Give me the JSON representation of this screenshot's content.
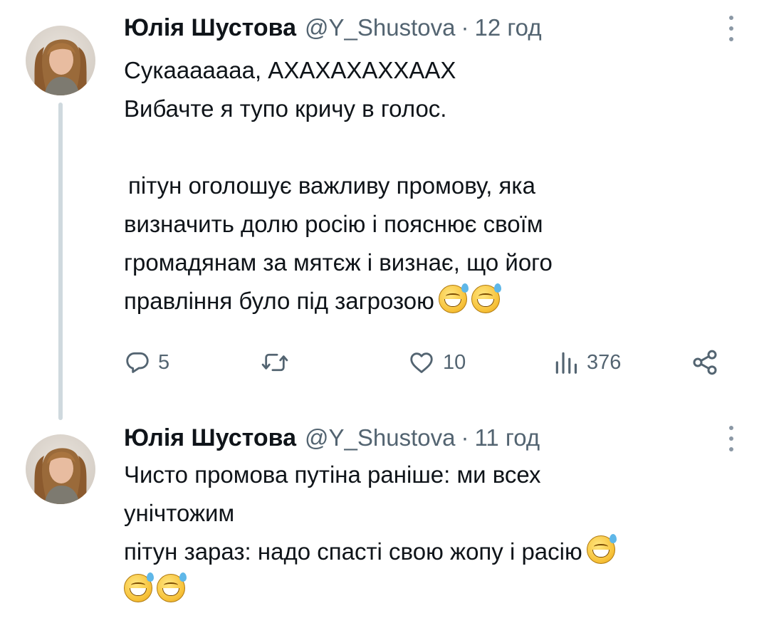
{
  "tweets": [
    {
      "author_name": "Юлія Шустова",
      "handle": "@Y_Shustova",
      "separator": "·",
      "time": "12 год",
      "lines": [
        "Сукааааааа, АХАХАХАХХААХ",
        "Вибачте я тупо кричу в голос.",
        "",
        "пітун оголошує важливу промову, яка",
        "визначить долю росію і пояснює своїм",
        "громадянам за мятєж і визнає, що його",
        "правління було під загрозою"
      ],
      "emoji": [
        "grinning-face-with-sweat",
        "grinning-face-with-sweat"
      ],
      "actions": {
        "reply_count": "5",
        "retweet_count": "",
        "like_count": "10",
        "view_count": "376"
      }
    },
    {
      "author_name": "Юлія Шустова",
      "handle": "@Y_Shustova",
      "separator": "·",
      "time": "11 год",
      "lines": [
        "Чисто промова путіна раніше: ми всех",
        "унічтожим",
        "пітун зараз: надо спасті свою жопу і расію"
      ],
      "emoji": [
        "grinning-face-with-sweat",
        "grinning-face-with-sweat",
        "grinning-face-with-sweat"
      ]
    }
  ],
  "colors": {
    "text": "#0f1419",
    "secondary": "#536471",
    "thread_line": "#cfd9de",
    "background": "#ffffff"
  },
  "icons": [
    "reply-icon",
    "retweet-icon",
    "like-icon",
    "views-icon",
    "share-icon",
    "more-icon"
  ]
}
